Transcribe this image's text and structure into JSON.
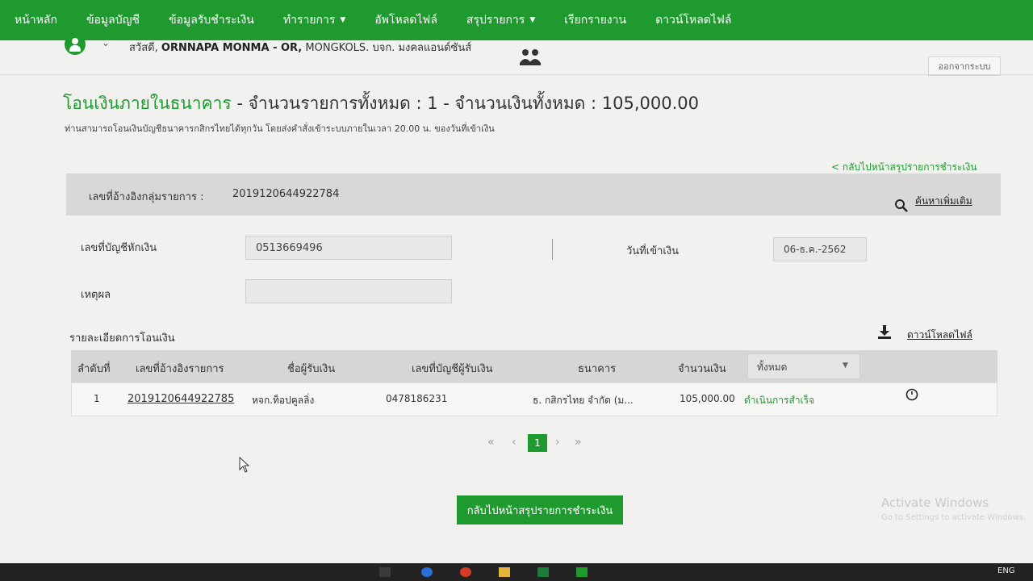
{
  "nav": {
    "items": [
      {
        "label": "หน้าหลัก",
        "dropdown": false
      },
      {
        "label": "ข้อมูลบัญชี",
        "dropdown": false
      },
      {
        "label": "ข้อมูลรับชำระเงิน",
        "dropdown": false
      },
      {
        "label": "ทำรายการ",
        "dropdown": true
      },
      {
        "label": "อัพโหลดไฟล์",
        "dropdown": false
      },
      {
        "label": "สรุปรายการ",
        "dropdown": true
      },
      {
        "label": "เรียกรายงาน",
        "dropdown": false
      },
      {
        "label": "ดาวน์โหลดไฟล์",
        "dropdown": false
      }
    ]
  },
  "user": {
    "greeting": "สวัสดี,",
    "name": "ORNNAPA MONMA - OR,",
    "company": "MONGKOLS. บจก. มงคลแอนด์ซันส์",
    "logout_label": "ออกจากระบบ"
  },
  "page": {
    "title_main": "โอนเงินภายในธนาคาร",
    "title_rest": "- จำนวนรายการทั้งหมด : 1 - จำนวนเงินทั้งหมด : 105,000.00",
    "subtitle": "ท่านสามารถโอนเงินบัญชีธนาคารกสิกรไทยได้ทุกวัน โดยส่งคำสั่งเข้าระบบภายในเวลา 20.00 น. ของวันที่เข้าเงิน",
    "back_link_top": "< กลับไปหน้าสรุปรายการชำระเงิน"
  },
  "group": {
    "label": "เลขที่อ้างอิงกลุ่มรายการ :",
    "value": "2019120644922784",
    "search_more": "ค้นหาเพิ่มเติม"
  },
  "form": {
    "debit_account_label": "เลขที่บัญชีหักเงิน",
    "debit_account_value": "0513669496",
    "value_date_label": "วันที่เข้าเงิน",
    "value_date_value": "06-ธ.ค.-2562",
    "reason_label": "เหตุผล",
    "reason_value": ""
  },
  "details": {
    "label": "รายละเอียดการโอนเงิน",
    "download_label": "ดาวน์โหลดไฟล์",
    "columns": [
      "ลำดับที่",
      "เลขที่อ้างอิงรายการ",
      "ชื่อผู้รับเงิน",
      "เลขที่บัญชีผู้รับเงิน",
      "ธนาคาร",
      "จำนวนเงิน"
    ],
    "filter_value": "ทั้งหมด",
    "rows": [
      {
        "no": "1",
        "ref": "2019120644922785",
        "payee": "หจก.ท็อปคูลลิ่ง",
        "account": "0478186231",
        "bank": "ธ. กสิกรไทย จำกัด (ม...",
        "amount": "105,000.00",
        "status": "ดำเนินการสำเร็จ"
      }
    ]
  },
  "pagination": {
    "first": "«",
    "prev": "‹",
    "current": "1",
    "next": "›",
    "last": "»"
  },
  "footer": {
    "back_button": "กลับไปหน้าสรุปรายการชำระเงิน"
  },
  "os": {
    "watermark": "Activate Windows",
    "watermark_sub": "Go to Settings to activate Windows.",
    "lang": "ENG"
  },
  "colors": {
    "brand": "#1f9a2e",
    "nav_text": "#ffffff"
  }
}
